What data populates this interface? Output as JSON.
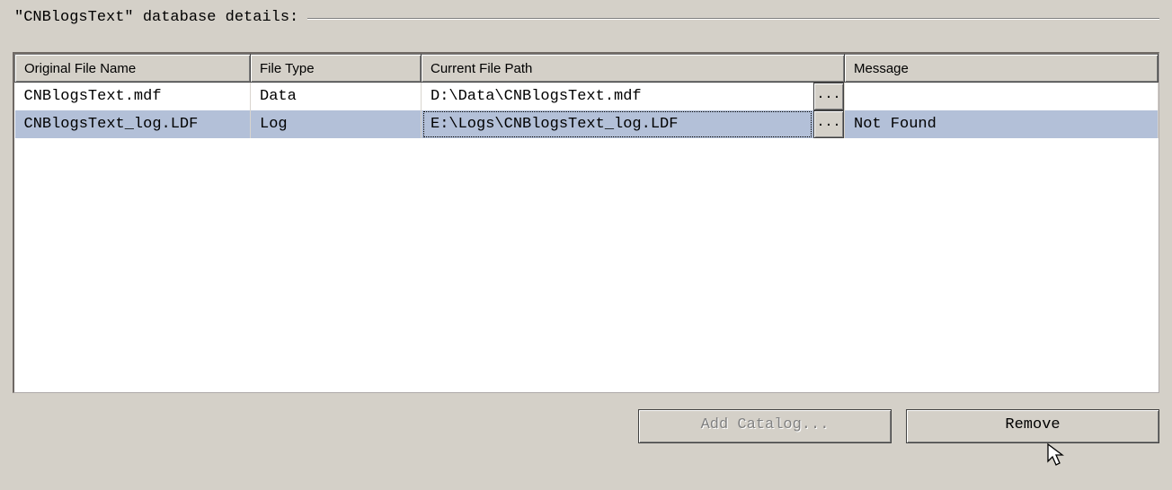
{
  "header": {
    "legend": "\"CNBlogsText\" database details:"
  },
  "grid": {
    "columns": {
      "original_file_name": "Original File Name",
      "file_type": "File Type",
      "current_file_path": "Current File Path",
      "message": "Message"
    },
    "browse_label": "...",
    "rows": [
      {
        "original_file_name": "CNBlogsText.mdf",
        "file_type": "Data",
        "current_file_path": "D:\\Data\\CNBlogsText.mdf",
        "message": "",
        "selected": false,
        "focused": false
      },
      {
        "original_file_name": "CNBlogsText_log.LDF",
        "file_type": "Log",
        "current_file_path": "E:\\Logs\\CNBlogsText_log.LDF",
        "message": "Not Found",
        "selected": true,
        "focused": true
      }
    ]
  },
  "buttons": {
    "add_catalog": "Add Catalog...",
    "remove": "Remove"
  }
}
